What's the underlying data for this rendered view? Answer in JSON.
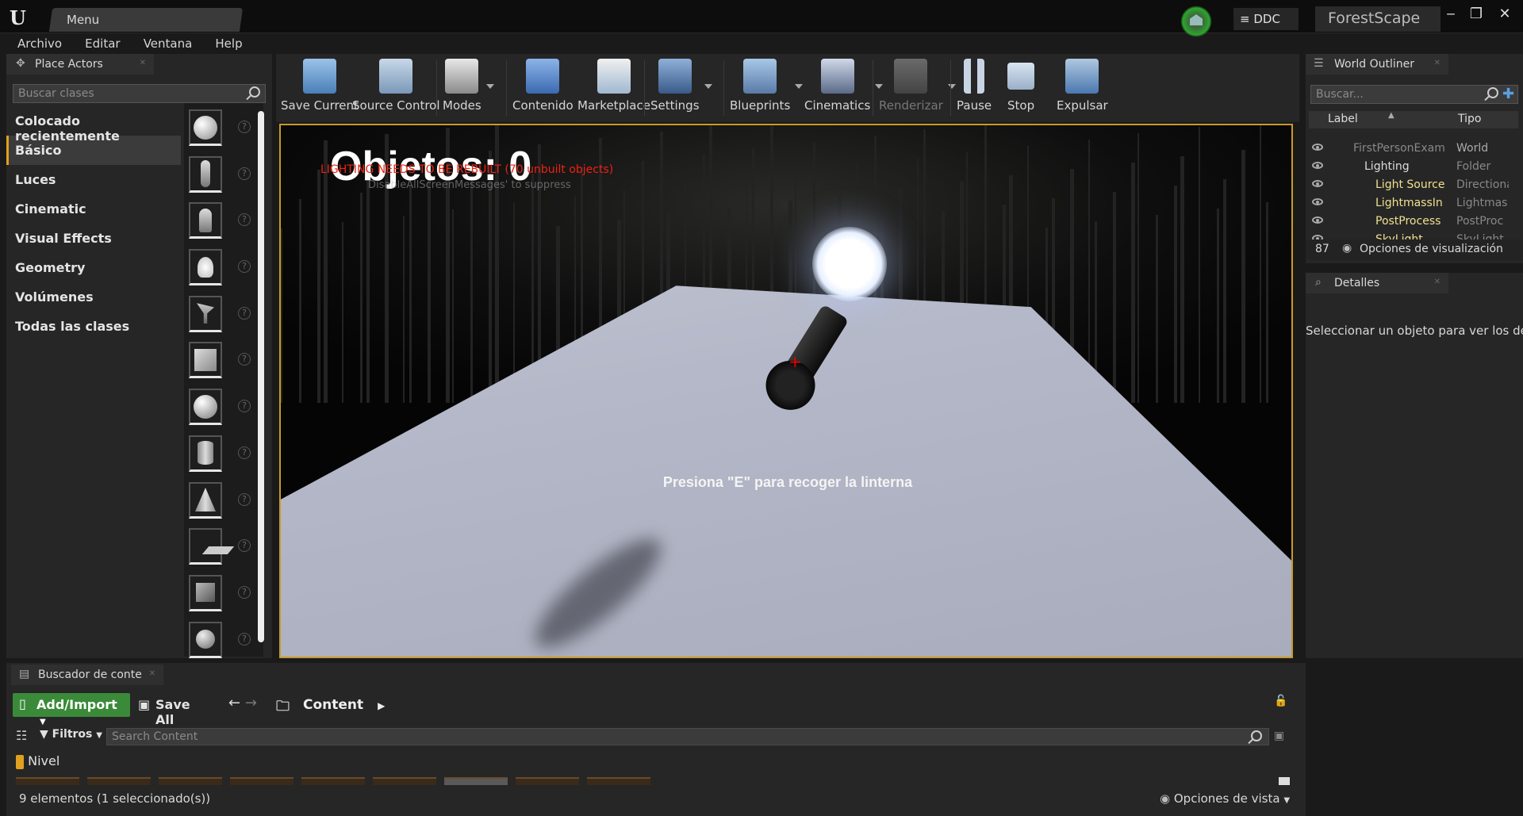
{
  "titlebar": {
    "menu_tab": "Menu",
    "ddc": "DDC",
    "project": "ForestScape",
    "window_controls": [
      "minimize",
      "restore",
      "close"
    ]
  },
  "menubar": [
    "Archivo",
    "Editar",
    "Ventana",
    "Help"
  ],
  "place_actors": {
    "tab": "Place Actors",
    "search_placeholder": "Buscar clases",
    "categories": [
      "Colocado recientemente",
      "Básico",
      "Luces",
      "Cinematic",
      "Visual Effects",
      "Geometry",
      "Volúmenes",
      "Todas las clases"
    ],
    "selected_category": "Básico",
    "actor_icons": [
      "empty-actor-sphere",
      "character",
      "pawn",
      "point-light",
      "player-start",
      "cube",
      "sphere",
      "cylinder",
      "cone",
      "plane",
      "box-trigger",
      "sphere-trigger"
    ]
  },
  "toolbar": {
    "items": [
      {
        "label": "Save Current",
        "icon": "save-icon",
        "dropdown": false
      },
      {
        "label": "Source Control",
        "icon": "source-control-icon",
        "dropdown": true
      },
      {
        "label": "Modes",
        "icon": "modes-icon",
        "dropdown": true
      },
      {
        "label": "Contenido",
        "icon": "content-icon",
        "dropdown": false
      },
      {
        "label": "Marketplace",
        "icon": "marketplace-icon",
        "dropdown": false
      },
      {
        "label": "Settings",
        "icon": "settings-icon",
        "dropdown": true
      },
      {
        "label": "Blueprints",
        "icon": "blueprints-icon",
        "dropdown": true
      },
      {
        "label": "Cinematics",
        "icon": "cinematics-icon",
        "dropdown": true
      },
      {
        "label": "Renderizar",
        "icon": "build-icon",
        "dropdown": true,
        "disabled": true
      },
      {
        "label": "Pause",
        "icon": "pause-icon",
        "dropdown": false
      },
      {
        "label": "Stop",
        "icon": "stop-icon",
        "dropdown": false
      },
      {
        "label": "Expulsar",
        "icon": "eject-icon",
        "dropdown": false
      }
    ]
  },
  "viewport": {
    "score_text": "Objetos: 0",
    "lighting_warning": "LIGHTING NEEDS TO BE REBUILT (70 unbuilt objects)",
    "suppress_hint": "DisableAllScreenMessages' to suppress",
    "prompt": "Presiona \"E\" para recoger la linterna"
  },
  "world_outliner": {
    "tab": "World Outliner",
    "search_placeholder": "Buscar...",
    "col_label": "Label",
    "col_type": "Tipo",
    "rows": [
      {
        "label": "FirstPersonExam",
        "type": "World",
        "depth": 0,
        "dim": true
      },
      {
        "label": "Lighting",
        "type": "Folder",
        "depth": 1,
        "dim": false
      },
      {
        "label": "Light Source",
        "type": "Directiona",
        "depth": 2,
        "dim": false
      },
      {
        "label": "LightmassIn",
        "type": "Lightmas",
        "depth": 2,
        "dim": false
      },
      {
        "label": "PostProcess",
        "type": "PostProc",
        "depth": 2,
        "dim": false
      },
      {
        "label": "SkyLight",
        "type": "SkyLight",
        "depth": 2,
        "dim": false
      }
    ],
    "count": "87",
    "view_options": "Opciones de visualización"
  },
  "details": {
    "tab": "Detalles",
    "message": "Seleccionar un objeto para ver los detalles."
  },
  "content_browser": {
    "tab": "Buscador de conte",
    "add_import": "Add/Import",
    "save_all": "Save All",
    "path": "Content",
    "filters": "Filtros",
    "search_placeholder": "Search Content",
    "filter_chip": "Nivel",
    "status": "9 elementos (1 seleccionado(s))",
    "view_options": "Opciones de vista"
  },
  "colors": {
    "accent_orange": "#e0a020",
    "viewport_border": "#c99a2a",
    "add_import_green": "#3a8a3a",
    "warning_red": "#e22211"
  }
}
